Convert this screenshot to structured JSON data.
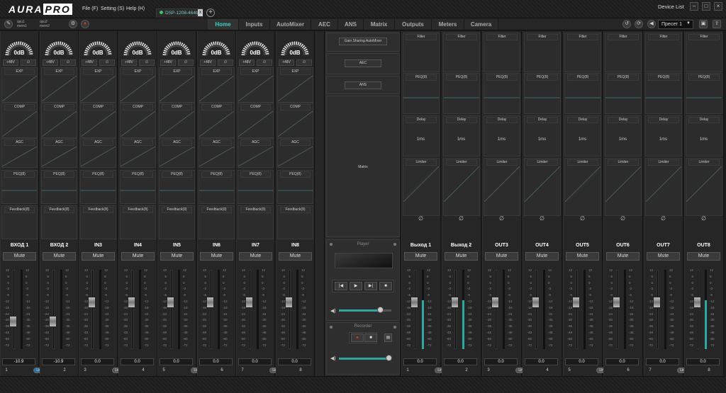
{
  "app": {
    "logo_main": "AURA",
    "logo_pro": "PRO",
    "menu": [
      "File (F)",
      "Setting (S)",
      "Help (H)"
    ],
    "device_tab": "DSP-1208-464b",
    "device_list": "Device List",
    "tab_close_icon": "close-icon",
    "add_tab_icon": "plus-icon"
  },
  "toolbar": {
    "mem1_top": "qsu1",
    "mem1_bottom": "mem1",
    "mem2_top": "qsu2",
    "mem2_bottom": "mem2",
    "tabs": [
      "Home",
      "Inputs",
      "AutoMixer",
      "AEC",
      "ANS",
      "Matrix",
      "Outputs",
      "Meters",
      "Camera"
    ],
    "active_tab": "Home",
    "preset": "Пресет 1"
  },
  "inputs": {
    "gain": "0dB",
    "phantom_label": "+48V",
    "phase_symbol": "∅",
    "exp_label": "EXP",
    "comp_label": "COMP",
    "agc_label": "AGC",
    "peq_label": "PEQ(8)",
    "feedback_label": "Feedback(8)",
    "mute_label": "Mute",
    "link_label": "Link",
    "channels": [
      {
        "name": "ВХОД 1",
        "value": "-10.9",
        "num": "1",
        "level": 0.35
      },
      {
        "name": "ВХОД 2",
        "value": "-10.9",
        "num": "2",
        "level": 0.35
      },
      {
        "name": "IN3",
        "value": "0.0",
        "num": "3",
        "level": 0.62
      },
      {
        "name": "IN4",
        "value": "0.0",
        "num": "4",
        "level": 0.62
      },
      {
        "name": "IN5",
        "value": "0.0",
        "num": "5",
        "level": 0.62
      },
      {
        "name": "IN6",
        "value": "0.0",
        "num": "6",
        "level": 0.62
      },
      {
        "name": "IN7",
        "value": "0.0",
        "num": "7",
        "level": 0.62
      },
      {
        "name": "IN8",
        "value": "0.0",
        "num": "8",
        "level": 0.62
      }
    ]
  },
  "scale_labels": [
    "12",
    "6",
    "0",
    "-3",
    "-6",
    "-12",
    "-18",
    "-24",
    "-30",
    "-36",
    "-48",
    "-60",
    "-72"
  ],
  "center": {
    "automixer": "Gain Sharing AutoMixer",
    "aec": "AEC",
    "ans": "ANS",
    "matrix": "Matrix",
    "player": "Player",
    "recorder": "Recorder",
    "prev_icon": "|◀",
    "play_icon": "▶",
    "next_icon": "▶|",
    "stop_icon": "■",
    "record_icon": "●",
    "speaker_icon": "◀)",
    "player_volume": 0.78,
    "recorder_volume": 0.95
  },
  "outputs": {
    "filter_label": "Filter",
    "peq_label": "PEQ(8)",
    "delay_label": "Delay",
    "delay_value": "1ms",
    "limiter_label": "Limiter",
    "phase_symbol": "∅",
    "mute_label": "Mute",
    "link_label": "Link",
    "channels": [
      {
        "name": "Выход 1",
        "value": "0.0",
        "num": "1",
        "level": 0.62,
        "meter": 0.62
      },
      {
        "name": "Выход 2",
        "value": "0.0",
        "num": "2",
        "level": 0.62,
        "meter": 0.62
      },
      {
        "name": "OUT3",
        "value": "0.0",
        "num": "3",
        "level": 0.62,
        "meter": 0.0
      },
      {
        "name": "OUT4",
        "value": "0.0",
        "num": "4",
        "level": 0.62,
        "meter": 0.0
      },
      {
        "name": "OUT5",
        "value": "0.0",
        "num": "5",
        "level": 0.62,
        "meter": 0.0
      },
      {
        "name": "OUT6",
        "value": "0.0",
        "num": "6",
        "level": 0.62,
        "meter": 0.0
      },
      {
        "name": "OUT7",
        "value": "0.0",
        "num": "7",
        "level": 0.62,
        "meter": 0.0
      },
      {
        "name": "OUT8",
        "value": "0.0",
        "num": "8",
        "level": 0.62,
        "meter": 0.62
      }
    ]
  }
}
